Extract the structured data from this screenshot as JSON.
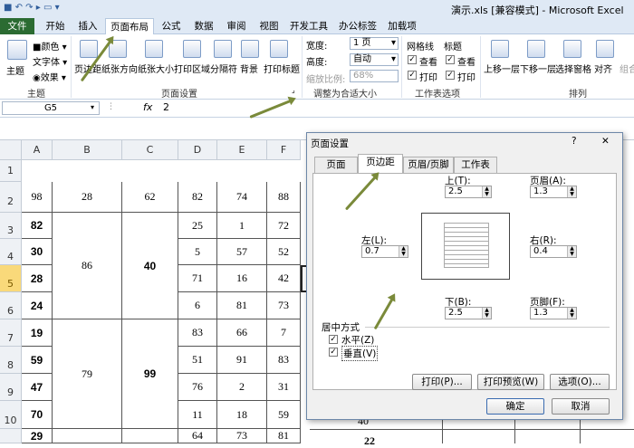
{
  "window": {
    "title": "演示.xls [兼容模式] - Microsoft Excel"
  },
  "ribbon_tabs": [
    "文件",
    "开始",
    "插入",
    "页面布局",
    "公式",
    "数据",
    "审阅",
    "视图",
    "开发工具",
    "办公标签",
    "加载项"
  ],
  "ribbon": {
    "theme": {
      "main": "主题",
      "colors": "颜色",
      "fonts": "字体",
      "effects": "效果",
      "group": "主题"
    },
    "page_setup": {
      "margins": "页边距",
      "orientation": "纸张方向",
      "size": "纸张大小",
      "print_area": "打印区域",
      "breaks": "分隔符",
      "background": "背景",
      "print_titles": "打印标题",
      "group": "页面设置"
    },
    "scale": {
      "width_label": "宽度:",
      "width_value": "1 页",
      "height_label": "高度:",
      "height_value": "自动",
      "scale_label": "缩放比例:",
      "scale_value": "68%",
      "group": "调整为合适大小"
    },
    "sheet_options": {
      "gridlines": "网格线",
      "headings": "标题",
      "view": "查看",
      "print": "打印",
      "group": "工作表选项"
    },
    "arrange": {
      "bring_forward": "上移一层",
      "send_backward": "下移一层",
      "selection_pane": "选择窗格",
      "align": "对齐",
      "group_btn": "组合",
      "group": "排列"
    }
  },
  "formula_bar": {
    "name_box": "G5",
    "fx": "fx",
    "value": "2"
  },
  "columns": [
    "A",
    "B",
    "C",
    "D",
    "E",
    "F"
  ],
  "rows": [
    "1",
    "2",
    "3",
    "4",
    "5",
    "6",
    "7",
    "8",
    "9",
    "10"
  ],
  "cells": {
    "r2": [
      "98",
      "28",
      "62",
      "82",
      "74",
      "88"
    ],
    "a": [
      "82",
      "30",
      "28",
      "24",
      "19",
      "59",
      "47",
      "70"
    ],
    "b_merged": [
      "86",
      "79"
    ],
    "c_merged": [
      "40",
      "99"
    ],
    "d": [
      "25",
      "5",
      "71",
      "6",
      "83",
      "51",
      "76",
      "11"
    ],
    "e": [
      "1",
      "57",
      "16",
      "81",
      "66",
      "91",
      "2",
      "18"
    ],
    "f": [
      "72",
      "52",
      "42",
      "73",
      "7",
      "83",
      "31",
      "59"
    ],
    "row11": [
      "29",
      "64",
      "73",
      "81"
    ],
    "g_peek": [
      "40",
      "22"
    ]
  },
  "dialog": {
    "title": "页面设置",
    "help": "?",
    "close": "✕",
    "tabs": [
      "页面",
      "页边距",
      "页眉/页脚",
      "工作表"
    ],
    "top_label": "上(T):",
    "top_value": "2.5",
    "header_label": "页眉(A):",
    "header_value": "1.3",
    "left_label": "左(L):",
    "left_value": "0.7",
    "right_label": "右(R):",
    "right_value": "0.4",
    "bottom_label": "下(B):",
    "bottom_value": "2.5",
    "footer_label": "页脚(F):",
    "footer_value": "1.3",
    "center_label": "居中方式",
    "horizontal": "水平(Z)",
    "vertical": "垂直(V)",
    "print_btn": "打印(P)...",
    "preview_btn": "打印预览(W)",
    "options_btn": "选项(O)...",
    "ok_btn": "确定",
    "cancel_btn": "取消"
  },
  "colors": {
    "file_tab": "#2b6b32",
    "arrow": "#7a8a3a",
    "selected_row": "#f9d97a"
  }
}
